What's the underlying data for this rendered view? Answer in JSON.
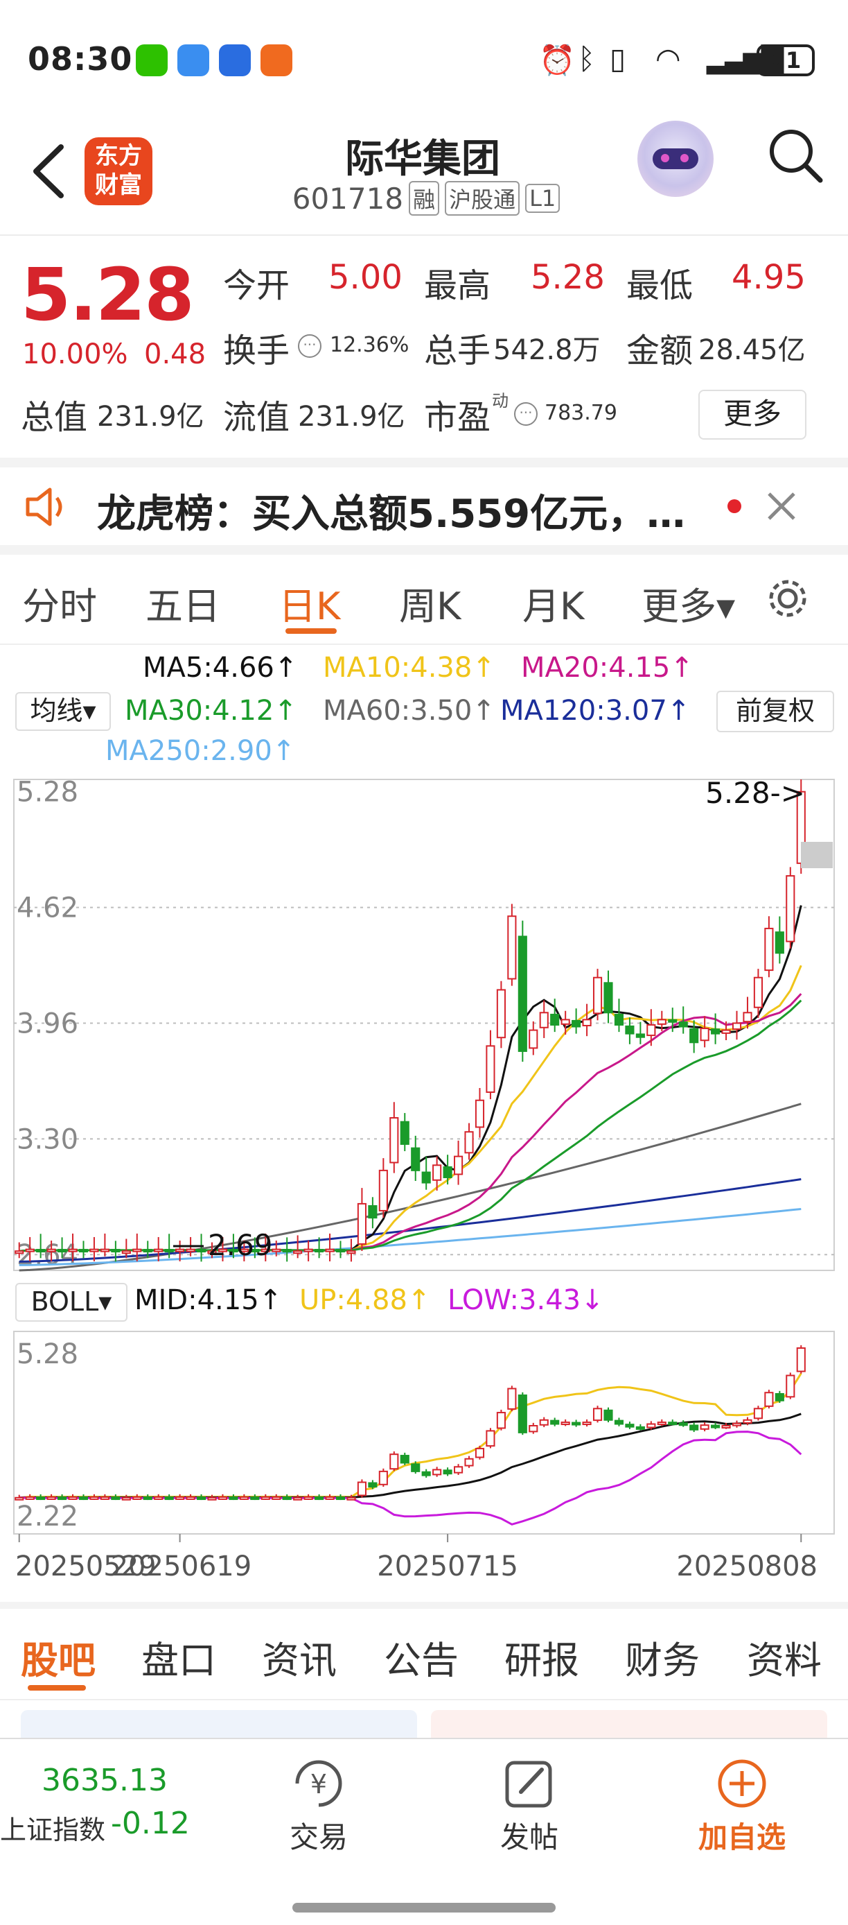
{
  "status": {
    "time": "08:30",
    "battery": "21"
  },
  "header": {
    "logo_line1": "东方",
    "logo_line2": "财富",
    "name": "际华集团",
    "code": "601718",
    "tags": [
      "融",
      "沪股通",
      "L1"
    ]
  },
  "quote": {
    "price": "5.28",
    "pct": "10.00%",
    "chg": "0.48",
    "open_label": "今开",
    "open": "5.00",
    "high_label": "最高",
    "high": "5.28",
    "low_label": "最低",
    "low": "4.95",
    "turnover_label": "换手",
    "turnover": "12.36%",
    "volume_label": "总手",
    "volume": "542.8万",
    "amount_label": "金额",
    "amount": "28.45亿",
    "mktcap_label": "总值",
    "mktcap": "231.9亿",
    "float_label": "流值",
    "float": "231.9亿",
    "pe_label": "市盈",
    "pe_sup": "动",
    "pe": "783.79",
    "more": "更多"
  },
  "notice": {
    "text": "龙虎榜：买入总额5.559亿元，…"
  },
  "tabs": {
    "items": [
      "分时",
      "五日",
      "日K",
      "周K",
      "月K",
      "更多▾"
    ],
    "active": 2
  },
  "ma": {
    "select": "均线▾",
    "ma5": "MA5:4.66↑",
    "ma10": "MA10:4.38↑",
    "ma20": "MA20:4.15↑",
    "ma30": "MA30:4.12↑",
    "ma60": "MA60:3.50↑",
    "ma120": "MA120:3.07↑",
    "ma250": "MA250:2.90↑",
    "fq": "前复权",
    "colors": {
      "ma5": "#111111",
      "ma10": "#f0c419",
      "ma20": "#c8188a",
      "ma30": "#1a9b2a",
      "ma60": "#666666",
      "ma120": "#1a2e9a",
      "ma250": "#6ab4ee"
    }
  },
  "boll": {
    "select": "BOLL▾",
    "mid": "MID:4.15↑",
    "up": "UP:4.88↑",
    "low": "LOW:3.43↓"
  },
  "chart_data": {
    "type": "candlestick",
    "yticks": [
      "5.28",
      "4.62",
      "3.96",
      "3.30",
      "2.64"
    ],
    "ylim": [
      2.55,
      5.35
    ],
    "marker_high": "5.28->",
    "marker_low": "2.69",
    "boll_yticks": [
      "5.28",
      "2.22"
    ],
    "dates": [
      "20250529",
      "20250619",
      "20250715",
      "20250808"
    ],
    "close": [
      2.66,
      2.67,
      2.66,
      2.67,
      2.66,
      2.67,
      2.66,
      2.67,
      2.67,
      2.66,
      2.66,
      2.67,
      2.66,
      2.67,
      2.66,
      2.67,
      2.67,
      2.66,
      2.66,
      2.67,
      2.66,
      2.67,
      2.66,
      2.67,
      2.67,
      2.66,
      2.66,
      2.67,
      2.66,
      2.67,
      2.66,
      2.66,
      2.93,
      2.85,
      3.12,
      3.42,
      3.27,
      3.12,
      3.05,
      3.15,
      3.08,
      3.2,
      3.34,
      3.52,
      3.83,
      4.15,
      4.57,
      3.8,
      3.92,
      4.02,
      3.95,
      3.98,
      3.94,
      3.98,
      4.22,
      4.02,
      3.95,
      3.9,
      3.88,
      3.95,
      3.98,
      3.97,
      3.94,
      3.85,
      3.93,
      3.9,
      3.92,
      3.96,
      4.02,
      4.22,
      4.5,
      4.36,
      4.8,
      5.28
    ],
    "up_color": "#d6242c",
    "down_color": "#1a9b2a"
  },
  "bottom_tabs": {
    "items": [
      "股吧",
      "盘口",
      "资讯",
      "公告",
      "研报",
      "财务",
      "资料"
    ],
    "active": 0
  },
  "footer": {
    "index_value": "3635.13",
    "index_name": "上证指数",
    "index_chg": "-0.12",
    "trade": "交易",
    "post": "发帖",
    "add": "加自选"
  }
}
